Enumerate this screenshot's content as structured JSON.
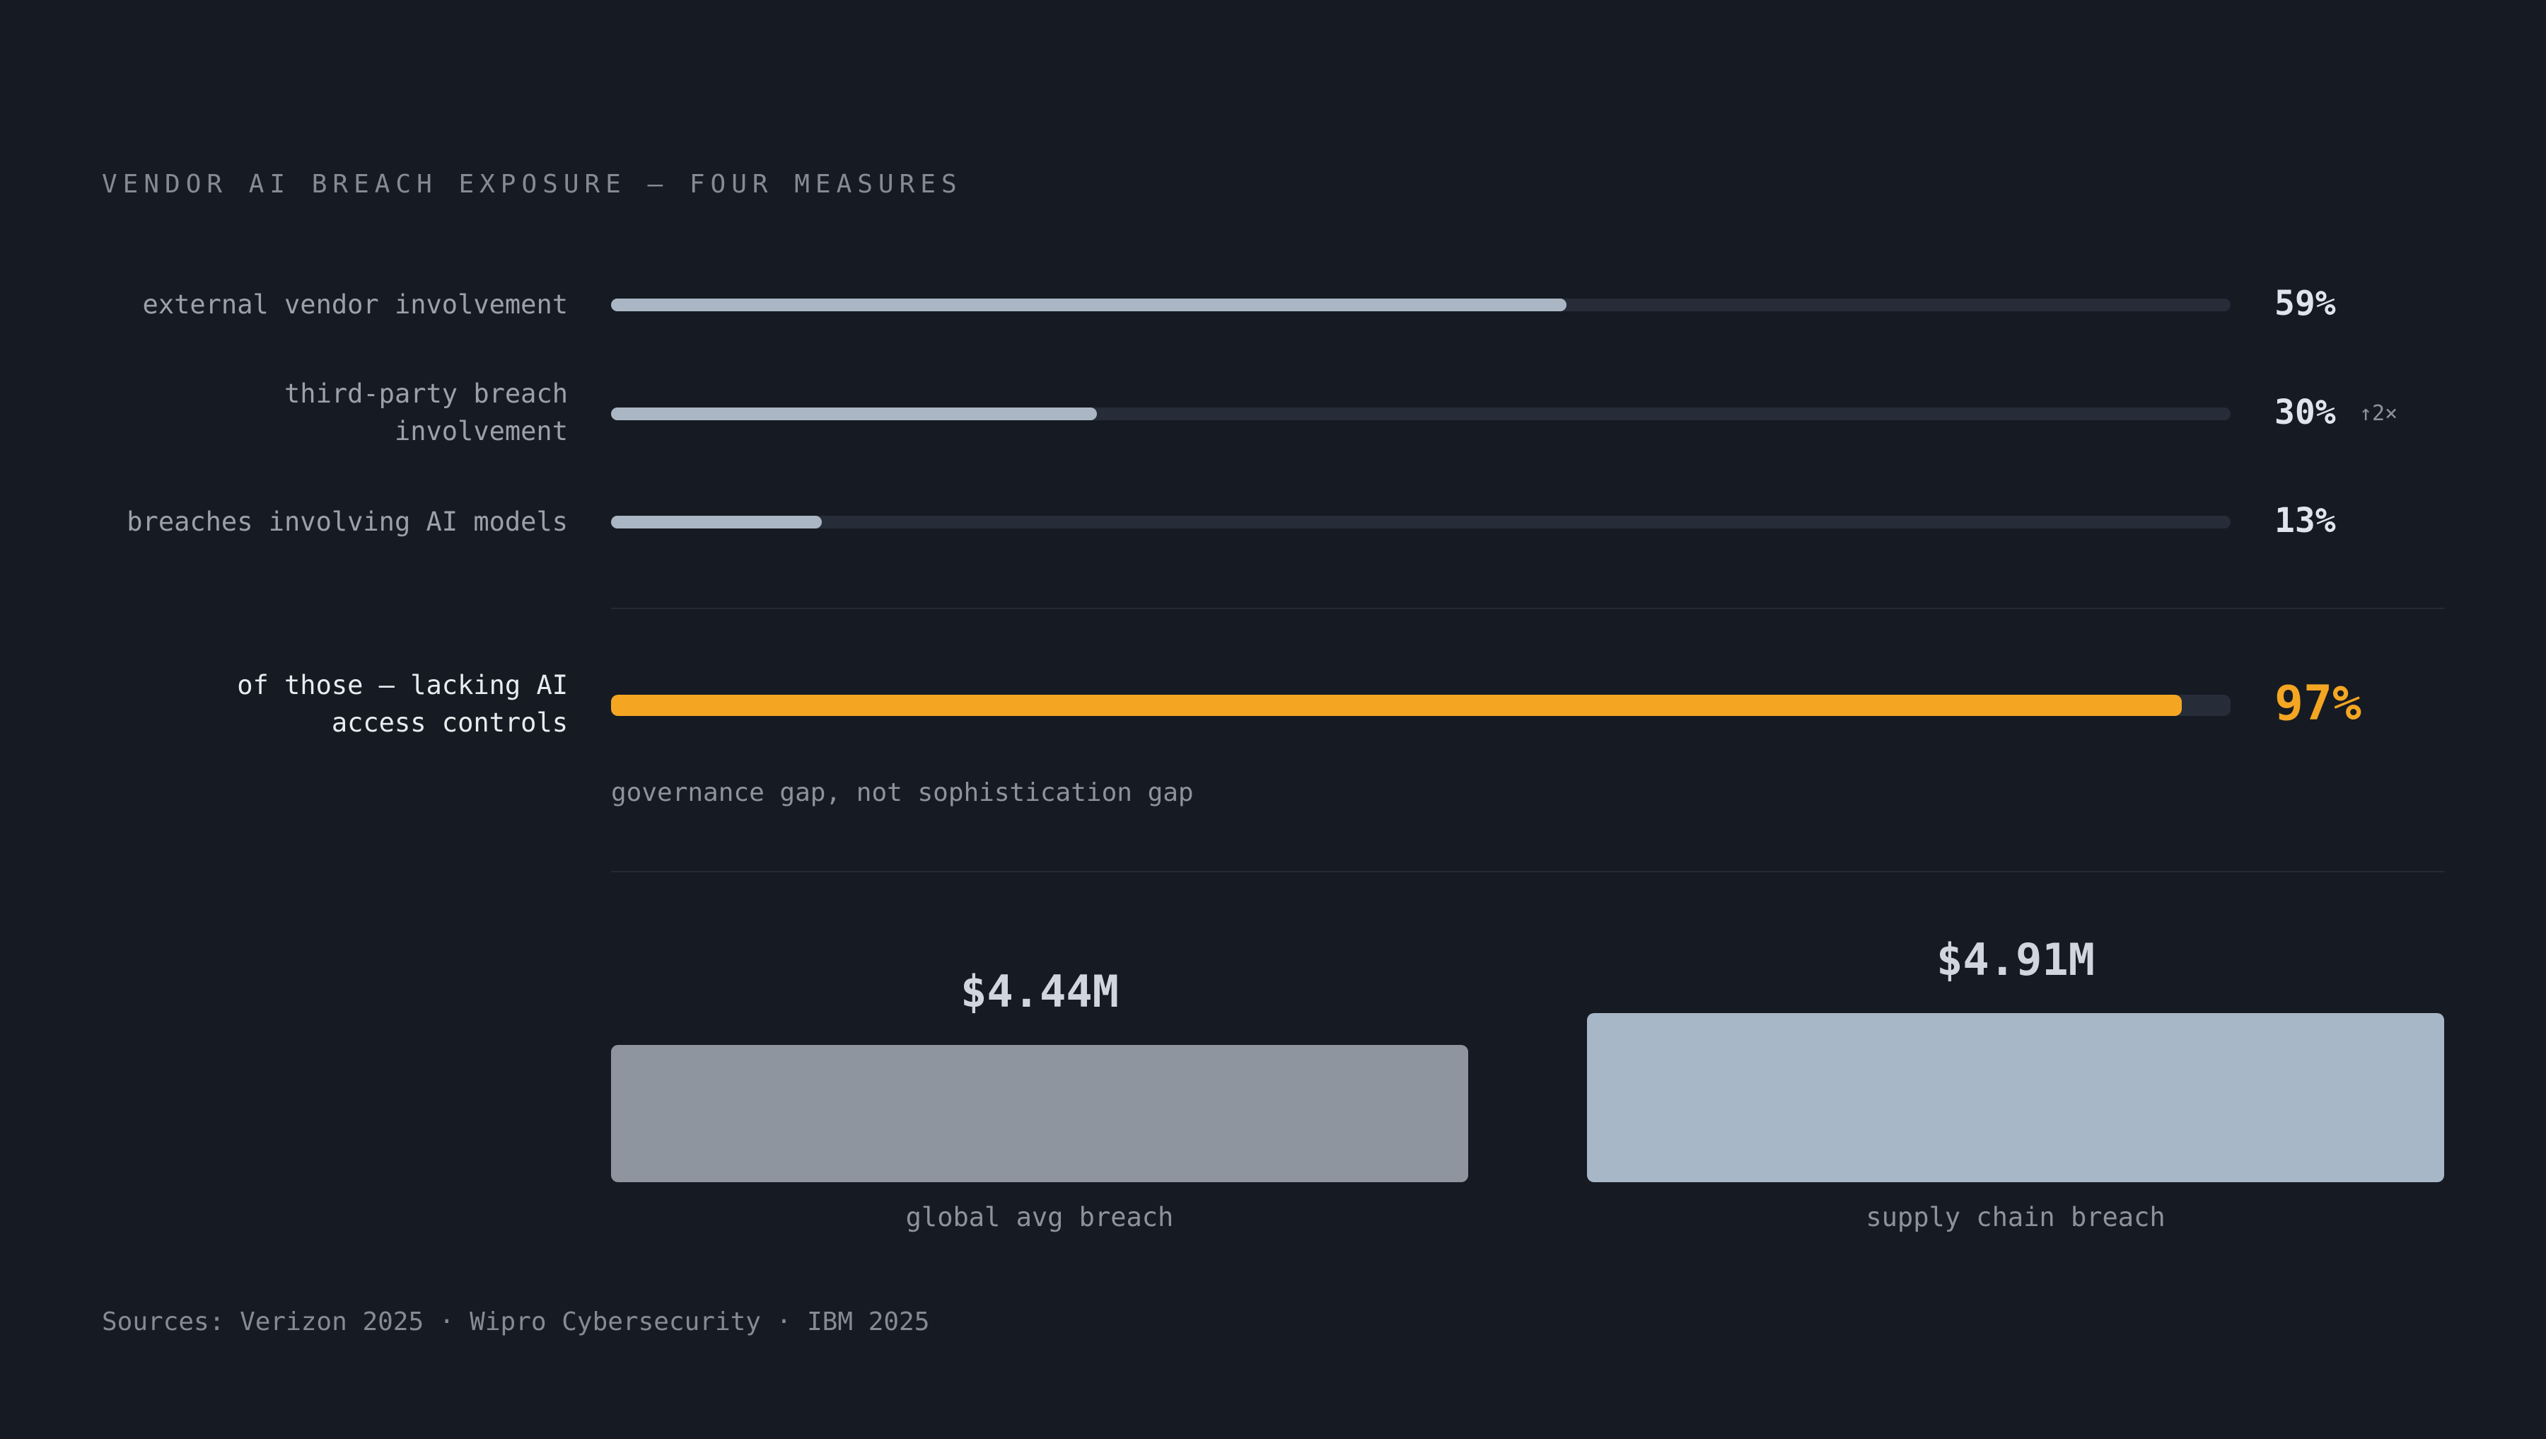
{
  "title": "VENDOR AI BREACH EXPOSURE — FOUR MEASURES",
  "note": "governance gap, not sophistication gap",
  "sources": "Sources: Verizon 2025 · Wipro Cybersecurity · IBM 2025",
  "colors": {
    "background": "#161b23",
    "track": "#262d39",
    "bar": "#aab6c3",
    "accent": "#f4a623",
    "global_bar": "#8e959e",
    "supply_bar": "#a8b7c7"
  },
  "chart_data": [
    {
      "type": "bar",
      "orientation": "horizontal",
      "unit": "%",
      "xlim": [
        0,
        100
      ],
      "categories": [
        "external vendor involvement",
        "third-party breach involvement",
        "breaches involving AI models",
        "of those — lacking AI access controls"
      ],
      "values": [
        59,
        30,
        13,
        97
      ],
      "value_labels": [
        "59%",
        "30%",
        "13%",
        "97%"
      ],
      "annotations": [
        {
          "category": "third-party breach involvement",
          "text": "↑2×"
        }
      ],
      "highlight": "of those — lacking AI access controls"
    },
    {
      "type": "bar",
      "orientation": "vertical",
      "categories": [
        "global avg breach",
        "supply chain breach"
      ],
      "values": [
        4.44,
        4.91
      ],
      "value_labels": [
        "$4.44M",
        "$4.91M"
      ]
    }
  ]
}
